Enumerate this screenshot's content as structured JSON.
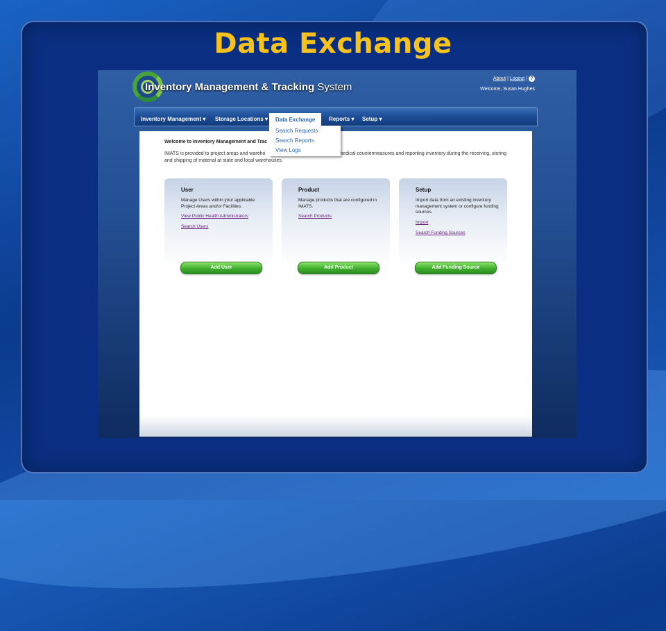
{
  "slide": {
    "title": "Data Exchange"
  },
  "app": {
    "name_bold": "Inventory Management & Tracking",
    "name_light": " System",
    "links": {
      "about": "About",
      "sep": "|",
      "logout": "Logout",
      "help": "?"
    },
    "welcome": "Welcome, Susan Hughes"
  },
  "nav": {
    "items": [
      "Inventory Management ▾",
      "Storage Locations ▾",
      "Data Exchange",
      "Reports ▾",
      "Setup ▾"
    ]
  },
  "dropdown": {
    "items": [
      "Search Requests",
      "Search Reports",
      "View Logs"
    ]
  },
  "content": {
    "heading": "Welcome to Inventory Management and Trac",
    "intro_left": "IMATS is provided to project areas and wareho",
    "intro_right": "medical countermeasures and reporting inventory during the receiving, storing",
    "intro_line2": "and shipping of material at state and local warehouses."
  },
  "cards": [
    {
      "title": "User",
      "desc": "Manage Users within your applicable Project Areas and/or Facilities.",
      "links": [
        "View Public Health Administrators",
        "Search Users"
      ],
      "button": "Add User"
    },
    {
      "title": "Product",
      "desc": "Manage products that are configured in IMATS.",
      "links": [
        "Search Products"
      ],
      "button": "Add Product"
    },
    {
      "title": "Setup",
      "desc": "Import data from an existing inventory management system or configure funding sources.",
      "links": [
        "Import",
        "Search Funding Sources"
      ],
      "button": "Add Funding Source"
    }
  ],
  "colors": {
    "title": "#f7c21b",
    "accent": "#2a68b8",
    "button": "#3fae2d"
  }
}
